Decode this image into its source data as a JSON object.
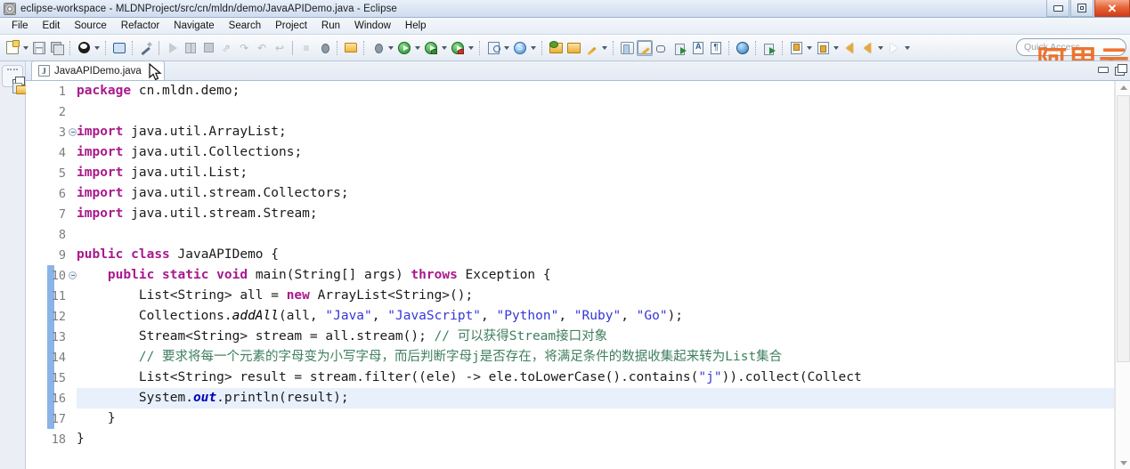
{
  "window": {
    "title": "eclipse-workspace - MLDNProject/src/cn/mldn/demo/JavaAPIDemo.java - Eclipse",
    "app_icon": "eclipse-icon",
    "controls": {
      "minimize": "minimize-icon",
      "restore": "restore-icon",
      "close": "close-icon"
    }
  },
  "menubar": {
    "items": [
      {
        "label": "File"
      },
      {
        "label": "Edit"
      },
      {
        "label": "Source"
      },
      {
        "label": "Refactor"
      },
      {
        "label": "Navigate"
      },
      {
        "label": "Search"
      },
      {
        "label": "Project"
      },
      {
        "label": "Run"
      },
      {
        "label": "Window"
      },
      {
        "label": "Help"
      }
    ]
  },
  "toolbar": {
    "quick_access_placeholder": "Quick Access",
    "watermark_text": "阿里云",
    "watermark_color": "#ec6a20",
    "groups": [
      {
        "icons": [
          "new-file-icon",
          "dropdown-arrow",
          "save-icon",
          "save-all-icon"
        ]
      },
      {
        "icons": [
          "user-icon",
          "dropdown-arrow"
        ]
      },
      {
        "icons": [
          "open-console-icon"
        ]
      },
      {
        "icons": [
          "toggle-pen-icon"
        ]
      },
      {
        "icons": [
          "resume-icon",
          "suspend-icon",
          "terminate-icon",
          "disconnect-icon",
          "step-into-icon",
          "step-over-icon",
          "step-return-icon"
        ]
      },
      {
        "icons": [
          "coverage-icon",
          "skip-breakpoints-icon"
        ]
      },
      {
        "icons": [
          "save-project-icon"
        ]
      },
      {
        "icons": [
          "debug-icon",
          "dropdown-arrow",
          "run-icon",
          "dropdown-arrow",
          "run-config-icon",
          "dropdown-arrow",
          "coverage-run-icon",
          "dropdown-arrow"
        ]
      },
      {
        "icons": [
          "new-java-class-icon",
          "dropdown-arrow",
          "new-java-project-icon",
          "dropdown-arrow"
        ]
      },
      {
        "icons": [
          "open-type-icon",
          "open-task-icon",
          "search-icon",
          "dropdown-arrow"
        ]
      },
      {
        "icons": [
          "perspective-icon",
          "java-perspective-icon"
        ]
      },
      {
        "icons": [
          "link-editor-icon",
          "external-tools-icon",
          "word-wrap-icon",
          "show-whitespace-icon"
        ]
      },
      {
        "icons": [
          "globe-icon",
          "annotation-next-icon",
          "next-annotation-icon",
          "dropdown-arrow",
          "prev-annotation-icon",
          "dropdown-arrow",
          "back-nav-icon",
          "forward-nav-icon",
          "dropdown-arrow",
          "forward-arrow-icon",
          "dropdown-arrow"
        ]
      }
    ]
  },
  "fastview": {
    "items": [
      {
        "name": "restore-view-icon",
        "label": "Restore"
      },
      {
        "name": "package-explorer-icon",
        "label": "Package Explorer"
      }
    ]
  },
  "editor": {
    "tab": {
      "icon": "java-file-icon",
      "icon_letter": "J",
      "title": "JavaAPIDemo.java",
      "close_glyph": "✕"
    },
    "view_tools": {
      "minimize": "minimize-view-icon",
      "maximize": "maximize-view-icon"
    },
    "current_line": 16,
    "scope_bar_range": [
      10,
      17
    ],
    "fold_lines": [
      3,
      10
    ],
    "scrollbar": {
      "up": "scroll-up-arrow",
      "down": "scroll-down-arrow"
    },
    "lines": [
      {
        "n": 1,
        "tokens": [
          {
            "t": "package",
            "c": "kw"
          },
          {
            "t": " cn.mldn.demo;",
            "c": "plain"
          }
        ]
      },
      {
        "n": 2,
        "tokens": []
      },
      {
        "n": 3,
        "tokens": [
          {
            "t": "import",
            "c": "kw"
          },
          {
            "t": " java.util.ArrayList;",
            "c": "plain"
          }
        ]
      },
      {
        "n": 4,
        "tokens": [
          {
            "t": "import",
            "c": "kw"
          },
          {
            "t": " java.util.Collections;",
            "c": "plain"
          }
        ]
      },
      {
        "n": 5,
        "tokens": [
          {
            "t": "import",
            "c": "kw"
          },
          {
            "t": " java.util.List;",
            "c": "plain"
          }
        ]
      },
      {
        "n": 6,
        "tokens": [
          {
            "t": "import",
            "c": "kw"
          },
          {
            "t": " java.util.stream.Collectors;",
            "c": "plain"
          }
        ]
      },
      {
        "n": 7,
        "tokens": [
          {
            "t": "import",
            "c": "kw"
          },
          {
            "t": " java.util.stream.Stream;",
            "c": "plain"
          }
        ]
      },
      {
        "n": 8,
        "tokens": []
      },
      {
        "n": 9,
        "tokens": [
          {
            "t": "public",
            "c": "kw"
          },
          {
            "t": " ",
            "c": "plain"
          },
          {
            "t": "class",
            "c": "kw"
          },
          {
            "t": " JavaAPIDemo {",
            "c": "plain"
          }
        ]
      },
      {
        "n": 10,
        "tokens": [
          {
            "t": "    ",
            "c": "plain"
          },
          {
            "t": "public",
            "c": "kw"
          },
          {
            "t": " ",
            "c": "plain"
          },
          {
            "t": "static",
            "c": "kw"
          },
          {
            "t": " ",
            "c": "plain"
          },
          {
            "t": "void",
            "c": "kw"
          },
          {
            "t": " main(String[] args) ",
            "c": "plain"
          },
          {
            "t": "throws",
            "c": "kw"
          },
          {
            "t": " Exception {",
            "c": "plain"
          }
        ]
      },
      {
        "n": 11,
        "tokens": [
          {
            "t": "        List<String> all = ",
            "c": "plain"
          },
          {
            "t": "new",
            "c": "kw"
          },
          {
            "t": " ArrayList<String>();",
            "c": "plain"
          }
        ]
      },
      {
        "n": 12,
        "tokens": [
          {
            "t": "        Collections.",
            "c": "plain"
          },
          {
            "t": "addAll",
            "c": "stm"
          },
          {
            "t": "(all, ",
            "c": "plain"
          },
          {
            "t": "\"Java\"",
            "c": "str"
          },
          {
            "t": ", ",
            "c": "plain"
          },
          {
            "t": "\"JavaScript\"",
            "c": "str"
          },
          {
            "t": ", ",
            "c": "plain"
          },
          {
            "t": "\"Python\"",
            "c": "str"
          },
          {
            "t": ", ",
            "c": "plain"
          },
          {
            "t": "\"Ruby\"",
            "c": "str"
          },
          {
            "t": ", ",
            "c": "plain"
          },
          {
            "t": "\"Go\"",
            "c": "str"
          },
          {
            "t": ");",
            "c": "plain"
          }
        ]
      },
      {
        "n": 13,
        "tokens": [
          {
            "t": "        Stream<String> stream = all.stream(); ",
            "c": "plain"
          },
          {
            "t": "// 可以获得Stream接口对象",
            "c": "cmt"
          }
        ]
      },
      {
        "n": 14,
        "tokens": [
          {
            "t": "        ",
            "c": "plain"
          },
          {
            "t": "// 要求将每一个元素的字母变为小写字母，而后判断字母j是否存在，将满足条件的数据收集起来转为List集合",
            "c": "cmt"
          }
        ]
      },
      {
        "n": 15,
        "tokens": [
          {
            "t": "        List<String> result = stream.filter((ele) -> ele.toLowerCase().contains(",
            "c": "plain"
          },
          {
            "t": "\"j\"",
            "c": "str"
          },
          {
            "t": ")).collect(Collect",
            "c": "plain"
          }
        ]
      },
      {
        "n": 16,
        "tokens": [
          {
            "t": "        System.",
            "c": "plain"
          },
          {
            "t": "out",
            "c": "fld"
          },
          {
            "t": ".println(result);",
            "c": "plain"
          }
        ]
      },
      {
        "n": 17,
        "tokens": [
          {
            "t": "    }",
            "c": "plain"
          }
        ]
      },
      {
        "n": 18,
        "tokens": [
          {
            "t": "}",
            "c": "plain"
          }
        ]
      }
    ]
  }
}
